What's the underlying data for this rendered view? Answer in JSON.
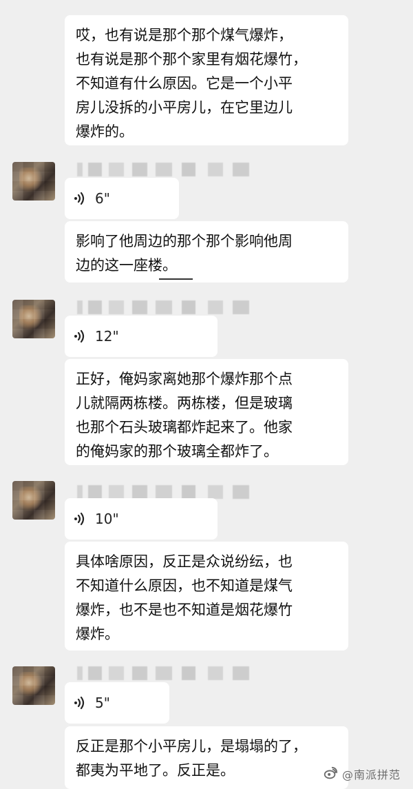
{
  "chat": {
    "messages": [
      {
        "type": "text",
        "text": "哎，也有说是那个那个煤气爆炸，\n也有说是那个那个家里有烟花爆竹，\n不知道有什么原因。它是一个小平\n房儿没拆的小平房儿，在它里边儿\n爆炸的。"
      },
      {
        "type": "voice",
        "duration": "6\"",
        "sender_avatar": "avatar"
      },
      {
        "type": "text",
        "text": "影响了他周边的那个那个影响他周\n边的这一座楼。"
      },
      {
        "type": "voice",
        "duration": "12\"",
        "sender_avatar": "avatar"
      },
      {
        "type": "text",
        "text": "正好，俺妈家离她那个爆炸那个点\n儿就隔两栋楼。两栋楼，但是玻璃\n也那个石头玻璃都炸起来了。他家\n的俺妈家的那个玻璃全都炸了。"
      },
      {
        "type": "voice",
        "duration": "10\"",
        "sender_avatar": "avatar"
      },
      {
        "type": "text",
        "text": "具体啥原因，反正是众说纷纭，也\n不知道什么原因，也不知道是煤气\n爆炸，也不是也不知道是烟花爆竹\n爆炸。"
      },
      {
        "type": "voice",
        "duration": "5\"",
        "sender_avatar": "avatar"
      },
      {
        "type": "text",
        "text": "反正是那个小平房儿，是塌塌的了，\n都夷为平地了。反正是。"
      }
    ],
    "watermark": "@南派拼范",
    "icons": {
      "voice": "voice-wave-icon",
      "watermark": "weibo-icon"
    },
    "colors": {
      "background": "#efefef",
      "bubble": "#ffffff",
      "text": "#111111",
      "muted": "#6b6b6b"
    }
  }
}
